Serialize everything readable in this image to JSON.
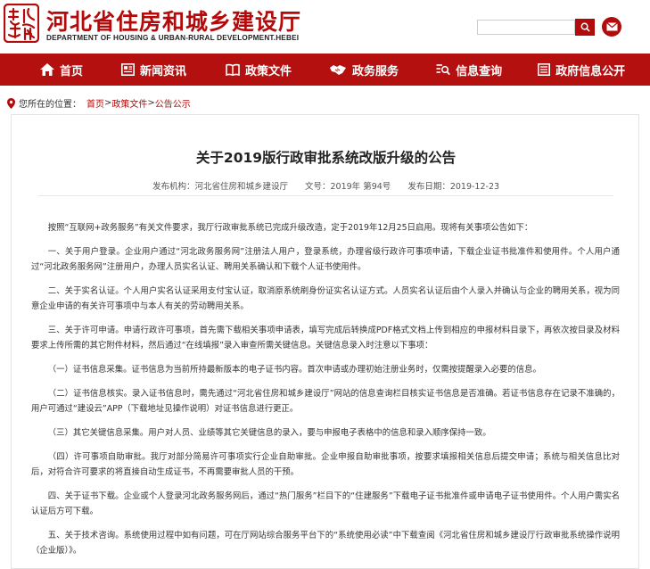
{
  "site": {
    "title": "河北省住房和城乡建设厅",
    "subtitle": "DEPARTMENT OF HOUSING & URBAN-RURAL DEVELOPMENT.HEBEI",
    "search_placeholder": "",
    "brand_color": "#b41010"
  },
  "nav": [
    {
      "label": "首页",
      "icon": "home-icon"
    },
    {
      "label": "新闻资讯",
      "icon": "newspaper-icon"
    },
    {
      "label": "政策文件",
      "icon": "book-icon"
    },
    {
      "label": "政务服务",
      "icon": "handshake-icon"
    },
    {
      "label": "信息查询",
      "icon": "search-list-icon"
    },
    {
      "label": "政府信息公开",
      "icon": "document-list-icon"
    }
  ],
  "breadcrumb": {
    "prefix": "您所在的位置：",
    "items": [
      "首页",
      "政策文件",
      "公告公示"
    ],
    "sep": ">"
  },
  "article": {
    "title": "关于2019版行政审批系统改版升级的公告",
    "publisher": "发布机构：河北省住房和城乡建设厅",
    "doc_no": "文号：2019年 第94号",
    "date": "发布日期：2019-12-23",
    "paragraphs": [
      "按照“互联网+政务服务”有关文件要求，我厅行政审批系统已完成升级改造，定于2019年12月25日启用。现将有关事项公告如下：",
      "一、关于用户登录。企业用户通过“河北政务服务网”注册法人用户，登录系统，办理省级行政许可事项申请，下载企业证书批准件和使用件。个人用户通过“河北政务服务网”注册用户，办理人员实名认证、聘用关系确认和下载个人证书使用件。",
      "二、关于实名认证。个人用户实名认证采用支付宝认证，取消原系统刷身份证实名认证方式。人员实名认证后由个人录入并确认与企业的聘用关系，视为同意企业申请的有关许可事项中与本人有关的劳动聘用关系。",
      "三、关于许可申请。申请行政许可事项，首先需下载相关事项申请表，填写完成后转换成PDF格式文档上传到相应的申报材料目录下，再依次按目录及材料要求上传所需的其它附件材料，然后通过“在线填报”录入审查所需关键信息。关键信息录入时注意以下事项：",
      "（一）证书信息采集。证书信息为当前所持最新版本的电子证书内容。首次申请或办理初始注册业务时，仅需按提醒录入必要的信息。",
      "（二）证书信息核实。录入证书信息时，需先通过“河北省住房和城乡建设厅”网站的信息查询栏目核实证书信息是否准确。若证书信息存在记录不准确的，用户可通过“建设云”APP（下载地址见操作说明）对证书信息进行更正。",
      "（三）其它关键信息采集。用户对人员、业绩等其它关键信息的录入，要与申报电子表格中的信息和录入顺序保持一致。",
      "（四）许可事项自助审批。我厅对部分简易许可事项实行企业自助审批。企业申报自助审批事项，按要求填报相关信息后提交申请；系统与相关信息比对后，对符合许可要求的将直接自动生成证书，不再需要审批人员的干预。",
      "四、关于证书下载。企业或个人登录河北政务服务网后，通过“热门服务”栏目下的“住建服务”下载电子证书批准件或申请电子证书使用件。个人用户需实名认证后方可下载。",
      "五、关于技术咨询。系统使用过程中如有问题，可在厅网站综合服务平台下的“系统使用必读”中下载查阅《河北省住房和城乡建设厅行政审批系统操作说明（企业版）》。"
    ]
  }
}
